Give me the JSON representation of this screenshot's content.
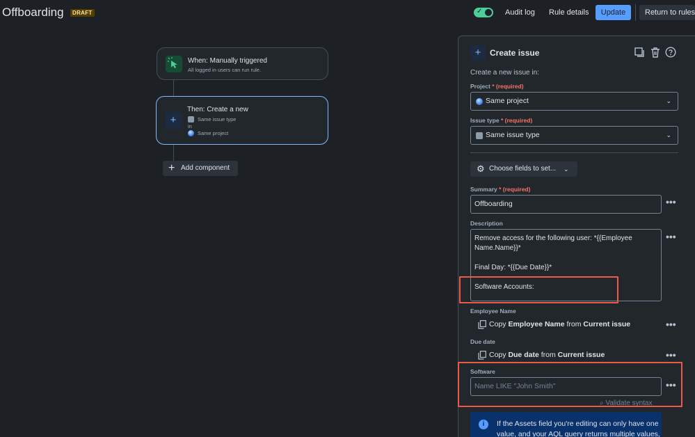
{
  "header": {
    "title": "Offboarding",
    "badge": "DRAFT",
    "audit_log": "Audit log",
    "rule_details": "Rule details",
    "update": "Update",
    "return": "Return to rules",
    "toggle_on": true
  },
  "flow": {
    "trigger_title": "When: Manually triggered",
    "trigger_sub": "All logged in users can run rule.",
    "action_title": "Then: Create a new",
    "action_issue_type": "Same issue type",
    "action_in": "in",
    "action_project": "Same project",
    "add_component": "Add component"
  },
  "panel": {
    "title": "Create issue",
    "intro": "Create a new issue in:",
    "project_label": "Project",
    "required": "(required)",
    "project_value": "Same project",
    "issue_type_label": "Issue type",
    "issue_type_value": "Same issue type",
    "choose_fields": "Choose fields to set...",
    "summary_label": "Summary",
    "summary_value": "Offboarding",
    "description_label": "Description",
    "description_lines": [
      "Remove access for the following user: *{{Employee",
      "Name.Name}}*",
      "",
      "Final Day: *{{Due Date}}*",
      "",
      "Software Accounts:"
    ],
    "employee_name_label": "Employee Name",
    "copy_word": "Copy",
    "employee_field": "Employee Name",
    "from_word": "from",
    "current_issue": "Current issue",
    "due_date_label": "Due date",
    "due_field": "Due date",
    "software_label": "Software",
    "software_placeholder": "Name LIKE \"John Smith\"",
    "validate": "Validate syntax",
    "info_text_1": "If the Assets field you're editing can only have one",
    "info_text_2": "value, and your AQL query returns multiple values,"
  },
  "colors": {
    "background": "#1d2125",
    "accent": "#579dff",
    "highlight": "#ee5a4a",
    "toggle": "#4bce97"
  }
}
